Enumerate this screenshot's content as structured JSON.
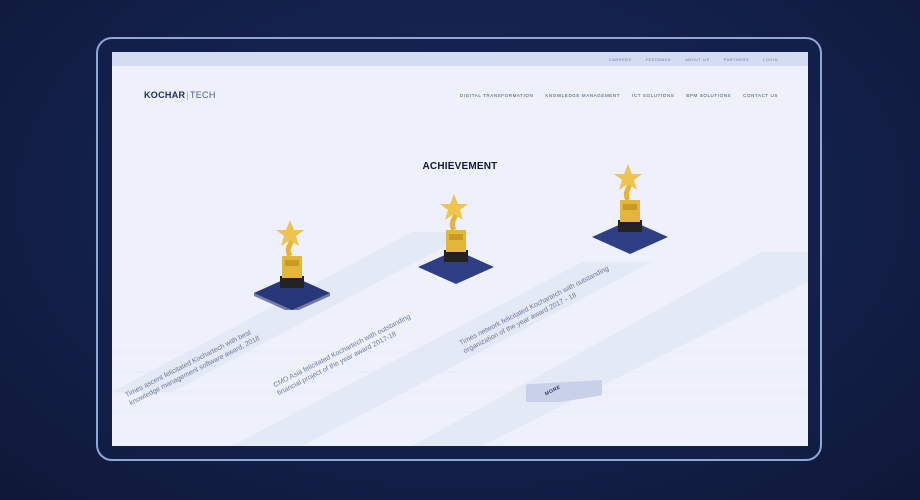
{
  "topbar": {
    "links": [
      "CAREERS",
      "FEEDBACK",
      "ABOUT US",
      "PARTNERS",
      "LOGIN"
    ]
  },
  "logo": {
    "bold": "KOCHAR",
    "light": "TECH"
  },
  "nav": {
    "items": [
      "DIGITAL TRANSFORMATION",
      "KNOWLEDGE MANAGEMENT",
      "ICT SOLUTIONS",
      "BPM SOLUTIONS",
      "CONTACT US"
    ]
  },
  "main": {
    "title": "ACHIEVEMENT",
    "awards": [
      {
        "caption": "Times ascent felicitated Kochartech with best knowledge management software award, 2018"
      },
      {
        "caption": "CMO Asia felicitated Kochartech with outstanding financial project of the year award 2017-18"
      },
      {
        "caption": "Times network felicitated Kochartech with outstanding organization of the year award 2017 - 18"
      }
    ],
    "more_label": "MORE"
  },
  "colors": {
    "background": "#13204a",
    "screen": "#eef1fb",
    "platform": "#2f3f86",
    "accent_gold": "#e3b53a"
  }
}
